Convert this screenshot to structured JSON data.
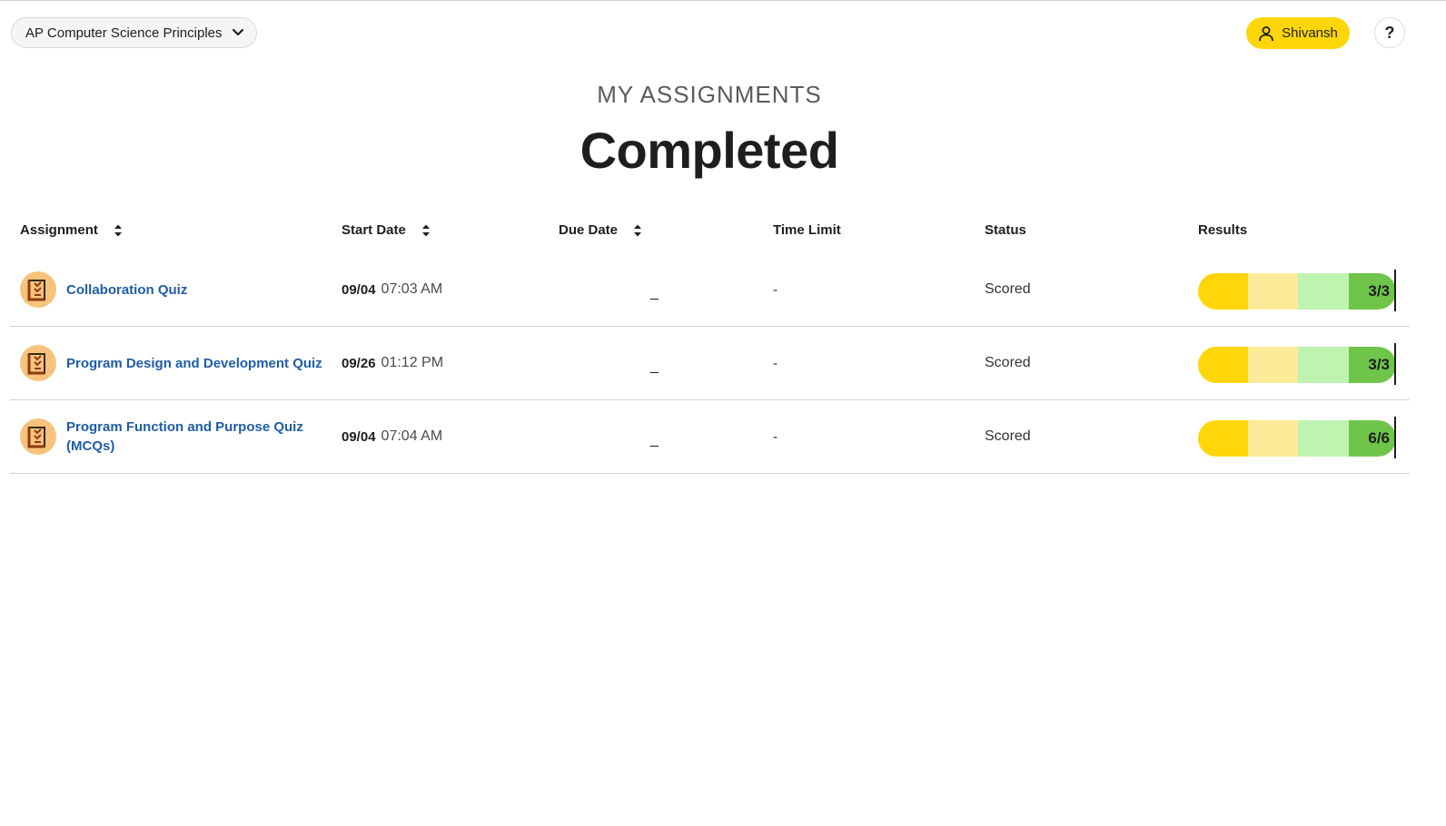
{
  "header": {
    "course_name": "AP Computer Science Principles",
    "user_name": "Shivansh",
    "help_label": "?"
  },
  "page": {
    "eyebrow": "MY ASSIGNMENTS",
    "title": "Completed"
  },
  "table": {
    "columns": {
      "assignment": "Assignment",
      "start_date": "Start Date",
      "due_date": "Due Date",
      "time_limit": "Time Limit",
      "status": "Status",
      "results": "Results"
    },
    "rows": [
      {
        "title": "Collaboration Quiz",
        "start_day": "09/04",
        "start_time": "07:03 AM",
        "due": "_",
        "time_limit": "-",
        "status": "Scored",
        "result": "3/3",
        "score_fraction": 1.0
      },
      {
        "title": "Program Design and Development Quiz",
        "start_day": "09/26",
        "start_time": "01:12 PM",
        "due": "_",
        "time_limit": "-",
        "status": "Scored",
        "result": "3/3",
        "score_fraction": 1.0
      },
      {
        "title": "Program Function and Purpose Quiz (MCQs)",
        "start_day": "09/04",
        "start_time": "07:04 AM",
        "due": "_",
        "time_limit": "-",
        "status": "Scored",
        "result": "6/6",
        "score_fraction": 1.0
      }
    ]
  },
  "colors": {
    "accent_yellow": "#ffd60a",
    "link_blue": "#1f5da8",
    "score_green": "#6fc549"
  },
  "icons": {
    "course_dropdown": "chevron-down-icon",
    "user": "user-icon",
    "sort": "sort-icon",
    "assignment": "quiz-checklist-icon"
  }
}
